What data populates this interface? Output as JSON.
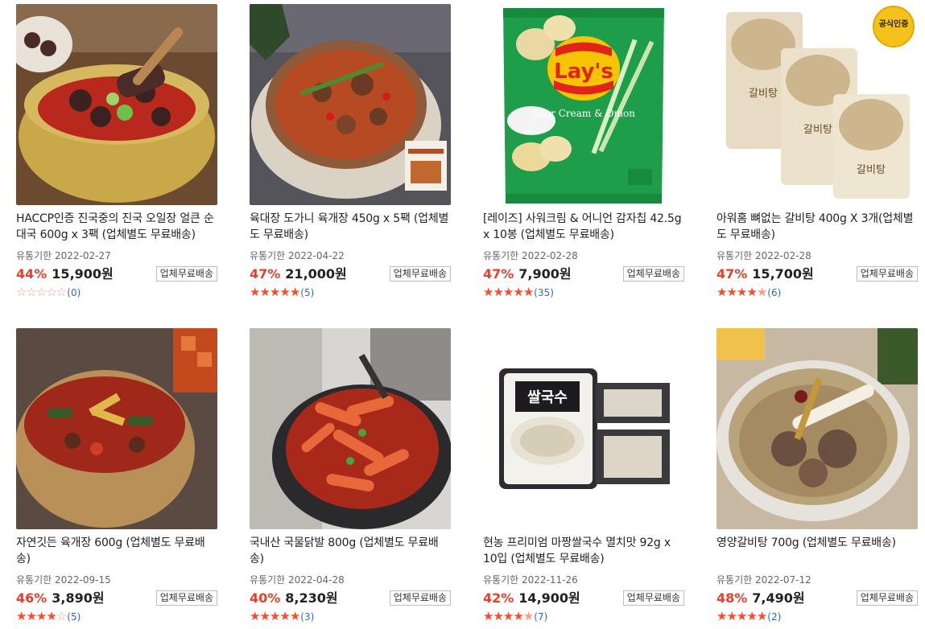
{
  "colors": {
    "discount": "#e8402c",
    "star": "#ff4a2a",
    "review_count": "#2c67d6"
  },
  "badge_label": "업체무료배송",
  "expiry_prefix": "유통기한",
  "products": [
    {
      "title": "HACCP인증 진국중의 진국 오일장 얼큰 순대국 600g x 3팩 (업체별도 무료배송)",
      "expiry": "유통기한 2022-02-27",
      "discount": "44%",
      "price": "15,900원",
      "badge": "업체무료배송",
      "rating_stars": 0,
      "review_count": "(0)",
      "image_icon": "sundae-soup-photo"
    },
    {
      "title": "육대장 도가니 육개장 450g x 5팩 (업체별도 무료배송)",
      "expiry": "유통기한 2022-04-22",
      "discount": "47%",
      "price": "21,000원",
      "badge": "업체무료배송",
      "rating_stars": 5,
      "review_count": "(5)",
      "image_icon": "yukgaejang-photo"
    },
    {
      "title": "[레이즈] 사워크림 & 어니언 감자칩 42.5g x 10봉 (업체별도 무료배송)",
      "expiry": "유통기한 2022-02-28",
      "discount": "47%",
      "price": "7,900원",
      "badge": "업체무료배송",
      "rating_stars": 5,
      "review_count": "(35)",
      "image_icon": "chips-bag-photo",
      "bag_text": {
        "brand": "Lay's",
        "flavor": "Sour Cream & Onion"
      }
    },
    {
      "title": "아워홈 뼈없는 갈비탕 400g X 3개(업체별도 무료배송)",
      "expiry": "유통기한 2022-02-28",
      "discount": "47%",
      "price": "15,700원",
      "badge": "업체무료배송",
      "rating_stars": 4.5,
      "review_count": "(6)",
      "image_icon": "galbitang-pouch-photo",
      "seal": "공식인증"
    },
    {
      "title": "자연깃든 육개장 600g (업체별도 무료배송)",
      "expiry": "유통기한 2022-09-15",
      "discount": "46%",
      "price": "3,890원",
      "badge": "업체무료배송",
      "rating_stars": 4,
      "review_count": "(5)",
      "image_icon": "yukgaejang-bowl-photo"
    },
    {
      "title": "국내산 국물닭발 800g (업체별도 무료배송)",
      "expiry": "유통기한 2022-04-28",
      "discount": "40%",
      "price": "8,230원",
      "badge": "업체무료배송",
      "rating_stars": 5,
      "review_count": "(3)",
      "image_icon": "chicken-feet-photo"
    },
    {
      "title": "현농 프리미엄 마짱쌀국수 멸치맛 92g x 10입 (업체별도 무료배송)",
      "expiry": "유통기한 2022-11-26",
      "discount": "42%",
      "price": "14,900원",
      "badge": "업체무료배송",
      "rating_stars": 4.5,
      "review_count": "(7)",
      "image_icon": "rice-noodle-pack-photo"
    },
    {
      "title": "영양갈비탕 700g (업체별도 무료배송)",
      "expiry": "유통기한 2022-07-12",
      "discount": "48%",
      "price": "7,490원",
      "badge": "업체무료배송",
      "rating_stars": 5,
      "review_count": "(2)",
      "image_icon": "galbitang-bowl-photo"
    }
  ]
}
